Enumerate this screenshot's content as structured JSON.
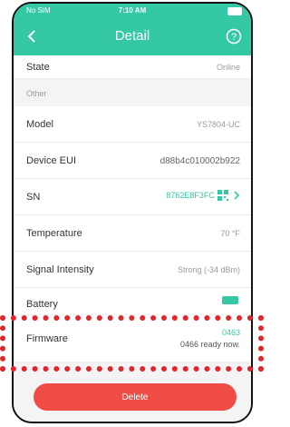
{
  "status_bar": {
    "carrier": "No SIM",
    "time": "7:10 AM"
  },
  "nav": {
    "title": "Detail"
  },
  "rows_top": [
    {
      "label": "State",
      "value": "Online"
    }
  ],
  "section_other": "Other",
  "rows": [
    {
      "label": "Model",
      "value": "YS7804-UC"
    },
    {
      "label": "Device EUI",
      "value": "d88b4c010002b922"
    },
    {
      "label": "SN",
      "value": "8762E8F3FC"
    },
    {
      "label": "Temperature",
      "value": "70 °F"
    },
    {
      "label": "Signal Intensity",
      "value": "Strong (-34 dBm)"
    },
    {
      "label": "Battery",
      "value": ""
    },
    {
      "label": "Firmware",
      "value": "0463",
      "value2": "0466 ready now."
    }
  ],
  "actions": {
    "delete_label": "Delete"
  },
  "colors": {
    "accent": "#34c9a4",
    "danger": "#f04b45",
    "highlight": "#e2252b"
  },
  "icons": [
    "back-icon",
    "help-icon",
    "qr-code-icon",
    "chevron-right-icon",
    "battery-icon"
  ]
}
